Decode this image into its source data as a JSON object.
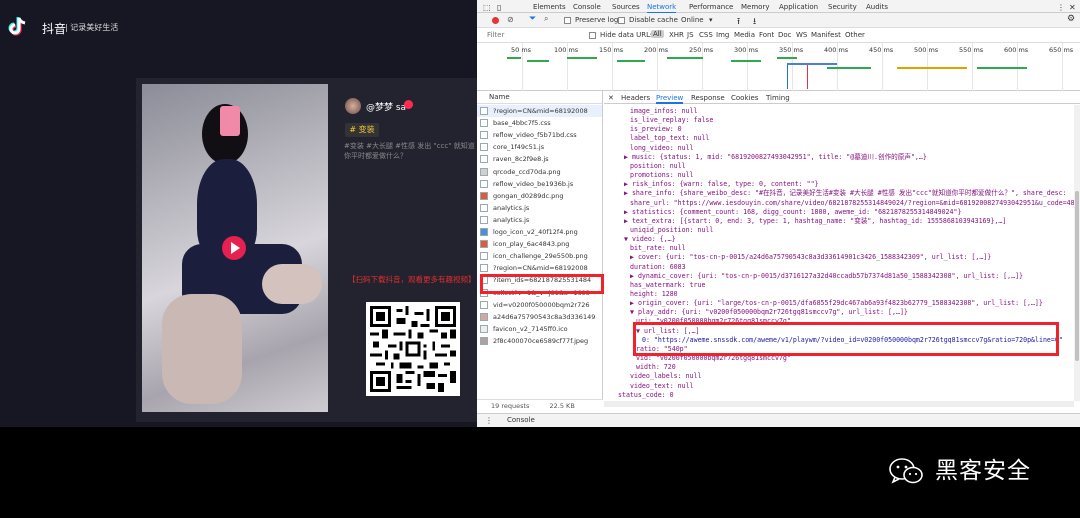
{
  "douyin": {
    "app_name": "抖音",
    "slogan": "| 记录美好生活",
    "author": "@梦梦 sa",
    "tag": "# 变装",
    "description": "#变装 #大长腿 #性感 发出 \"ccc\" 就知道你平时都爱做什么？",
    "promo": "【扫码下载抖音，观看更多有趣视频】"
  },
  "devtools": {
    "panel_tabs": [
      "Elements",
      "Console",
      "Sources",
      "Network",
      "Performance",
      "Memory",
      "Application",
      "Security",
      "Audits"
    ],
    "active_panel": "Network",
    "toolbar": {
      "preserve_log": "Preserve log",
      "disable_cache": "Disable cache",
      "throttle": "Online"
    },
    "filter": {
      "placeholder": "Filter",
      "hide_data_urls": "Hide data URLs",
      "types": [
        "All",
        "XHR",
        "JS",
        "CSS",
        "Img",
        "Media",
        "Font",
        "Doc",
        "WS",
        "Manifest",
        "Other"
      ]
    },
    "timeline_ticks": [
      "50 ms",
      "100 ms",
      "150 ms",
      "200 ms",
      "250 ms",
      "300 ms",
      "350 ms",
      "400 ms",
      "450 ms",
      "500 ms",
      "550 ms",
      "600 ms",
      "650 ms"
    ],
    "name_header": "Name",
    "requests": [
      "?region=CN&mid=68192008",
      "base_4bbc7f5.css",
      "reflow_video_f5b71bd.css",
      "core_1f49c51.js",
      "raven_8c2f9e8.js",
      "qrcode_ccd70da.png",
      "reflow_video_be1936b.js",
      "gongan_d0289dc.png",
      "analytics.js",
      "analytics.js",
      "logo_icon_v2_40f12f4.png",
      "icon_play_6ac4843.png",
      "icon_challenge_29e550b.png",
      "?region=CN&mid=68192008",
      "?item_ids=682187825531484",
      "collect?v=1&_v=j81&a=1693",
      "vid=v0200f050000bqm2r726",
      "a24d6a75790543c8a3d336149",
      "favicon_v2_7145ff0.ico",
      "2f8c400070ce6589cf77f.jpeg"
    ],
    "footer_requests": "19 requests",
    "footer_transferred": "22.5 KB transferred",
    "detail_tabs": [
      "Headers",
      "Preview",
      "Response",
      "Cookies",
      "Timing"
    ],
    "active_detail_tab": "Preview",
    "json_lines": [
      "image_infos: null",
      "is_live_replay: false",
      "is_preview: 0",
      "label_top_text: null",
      "long_video: null",
      "▶ music: {status: 1, mid: \"6819200827493042951\", title: \"@墓迪川.创作的原声\",…}",
      "position: null",
      "promotions: null",
      "▶ risk_infos: {warn: false, type: 0, content: \"\"}",
      "▶ share_info: {share_weibo_desc: \"#在抖音，记录美好生活#变装 #大长腿 #性感 发出\"ccc\"就知道你平时都爱做什么？\", share_desc:",
      "share_url: \"https://www.iesdouyin.com/share/video/6821878255314849024/?region=&mid=6819200827493042951&u_code=48&ti",
      "▶ statistics: {comment_count: 168, digg_count: 1800, aweme_id: \"6821878255314849024\"}",
      "▶ text_extra: [{start: 0, end: 3, type: 1, hashtag_name: \"变装\", hashtag_id: 1555868103943169},…]",
      "uniqid_position: null",
      "▼ video: {,…}",
      "bit_rate: null",
      "▶ cover: {uri: \"tos-cn-p-0015/a24d6a75790543c8a3d33614901c3426_1588342309\", url_list: [,…]}",
      "duration: 6083",
      "▶ dynamic_cover: {uri: \"tos-cn-p-0015/d3716127a32d40ccadb57b7374d81a50_1588342308\", url_list: [,…]}",
      "has_watermark: true",
      "height: 1280",
      "▶ origin_cover: {uri: \"large/tos-cn-p-0015/dfa6855f29dc467ab6a93f4823b62779_1588342308\", url_list: [,…]}",
      "▼ play_addr: {uri: \"v0200f050000bqm2r726tgq81smccv7g\", url_list: [,…]}",
      "uri: \"v0200f050000bqm2r726tgq81smccv7g\"",
      "▼ url_list: [,…]",
      "0: \"https://aweme.snssdk.com/aweme/v1/playwm/?video_id=v0200f050000bqm2r726tgq81smccv7g&ratio=720p&line=0\"",
      "ratio: \"540p\"",
      "vid: \"v0200f050000bqm2r726tgq81smccv7g\"",
      "width: 720",
      "video_labels: null",
      "video_text: null",
      "status_code: 0"
    ],
    "console_label": "Console"
  },
  "watermark": {
    "name": "黑客安全"
  }
}
